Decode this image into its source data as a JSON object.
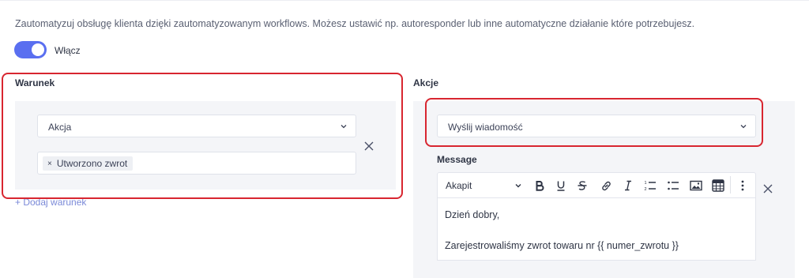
{
  "description": "Zautomatyzuj obsługę klienta dzięki zautomatyzowanym workflows. Możesz ustawić np. autoresponder lub inne automatyczne działanie które potrzebujesz.",
  "toggle": {
    "label": "Włącz",
    "enabled": true
  },
  "condition": {
    "title": "Warunek",
    "select_value": "Akcja",
    "tags": [
      "Utworzono zwrot"
    ],
    "tag_remove_glyph": "×",
    "add_link": "+ Dodaj warunek"
  },
  "actions": {
    "title": "Akcje",
    "select_value": "Wyślij wiadomość",
    "message_label": "Message",
    "toolbar": {
      "paragraph_style": "Akapit",
      "buttons": [
        "bold-icon",
        "underline-icon",
        "strikethrough-icon",
        "link-icon",
        "italic-icon",
        "ordered-list-icon",
        "bullet-list-icon",
        "image-icon",
        "table-icon",
        "more-icon"
      ]
    },
    "editor_lines": [
      "Dzień dobry,",
      "Zarejestrowaliśmy zwrot towaru nr {{ numer_zwrotu }}"
    ]
  },
  "colors": {
    "accent": "#5a6ff0",
    "highlight": "#d82630",
    "link": "#7b8ad8",
    "panel": "#f4f5f8"
  }
}
